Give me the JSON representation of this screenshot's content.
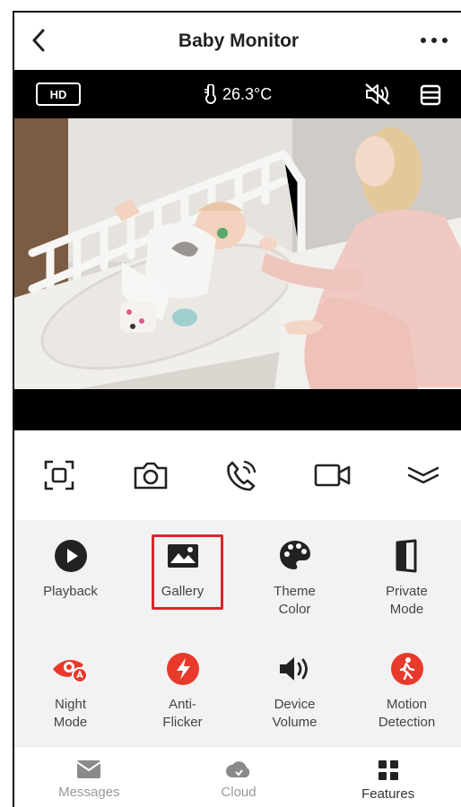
{
  "header": {
    "title": "Baby Monitor",
    "back_icon": "chevron-left-icon",
    "more_icon": "more-dots-icon"
  },
  "video_bar": {
    "quality": "HD",
    "temperature": "26.3°C",
    "temperature_icon": "thermometer-icon",
    "mute_icon": "speaker-muted-icon",
    "layout_icon": "layout-icon"
  },
  "video": {
    "description_icon": "live-camera-feed"
  },
  "controls": [
    {
      "name": "fullscreen-button",
      "icon": "fullscreen-icon"
    },
    {
      "name": "snapshot-button",
      "icon": "camera-icon"
    },
    {
      "name": "talk-button",
      "icon": "phone-icon"
    },
    {
      "name": "record-button",
      "icon": "video-camera-icon"
    },
    {
      "name": "collapse-button",
      "icon": "chevron-double-down-icon"
    }
  ],
  "features": [
    {
      "label": "Playback",
      "icon": "play-circle-icon",
      "color": "#222222"
    },
    {
      "label": "Gallery",
      "icon": "image-icon",
      "color": "#222222",
      "selected": true
    },
    {
      "label": "Theme\nColor",
      "icon": "palette-icon",
      "color": "#222222"
    },
    {
      "label": "Private\nMode",
      "icon": "privacy-shield-icon",
      "color": "#222222"
    },
    {
      "label": "Night\nMode",
      "icon": "night-eye-icon",
      "color": "#e8392b"
    },
    {
      "label": "Anti-\nFlicker",
      "icon": "lightning-icon",
      "color": "#e8392b"
    },
    {
      "label": "Device\nVolume",
      "icon": "volume-icon",
      "color": "#222222"
    },
    {
      "label": "Motion\nDetection",
      "icon": "walking-person-icon",
      "color": "#e8392b"
    }
  ],
  "tabs": [
    {
      "label": "Messages",
      "icon": "mail-icon"
    },
    {
      "label": "Cloud",
      "icon": "cloud-icon"
    },
    {
      "label": "Features",
      "icon": "grid-icon",
      "active": true
    }
  ],
  "colors": {
    "accent_red": "#e8392b",
    "selection_border": "#d9262b",
    "panel_bg": "#f2f2f2"
  }
}
